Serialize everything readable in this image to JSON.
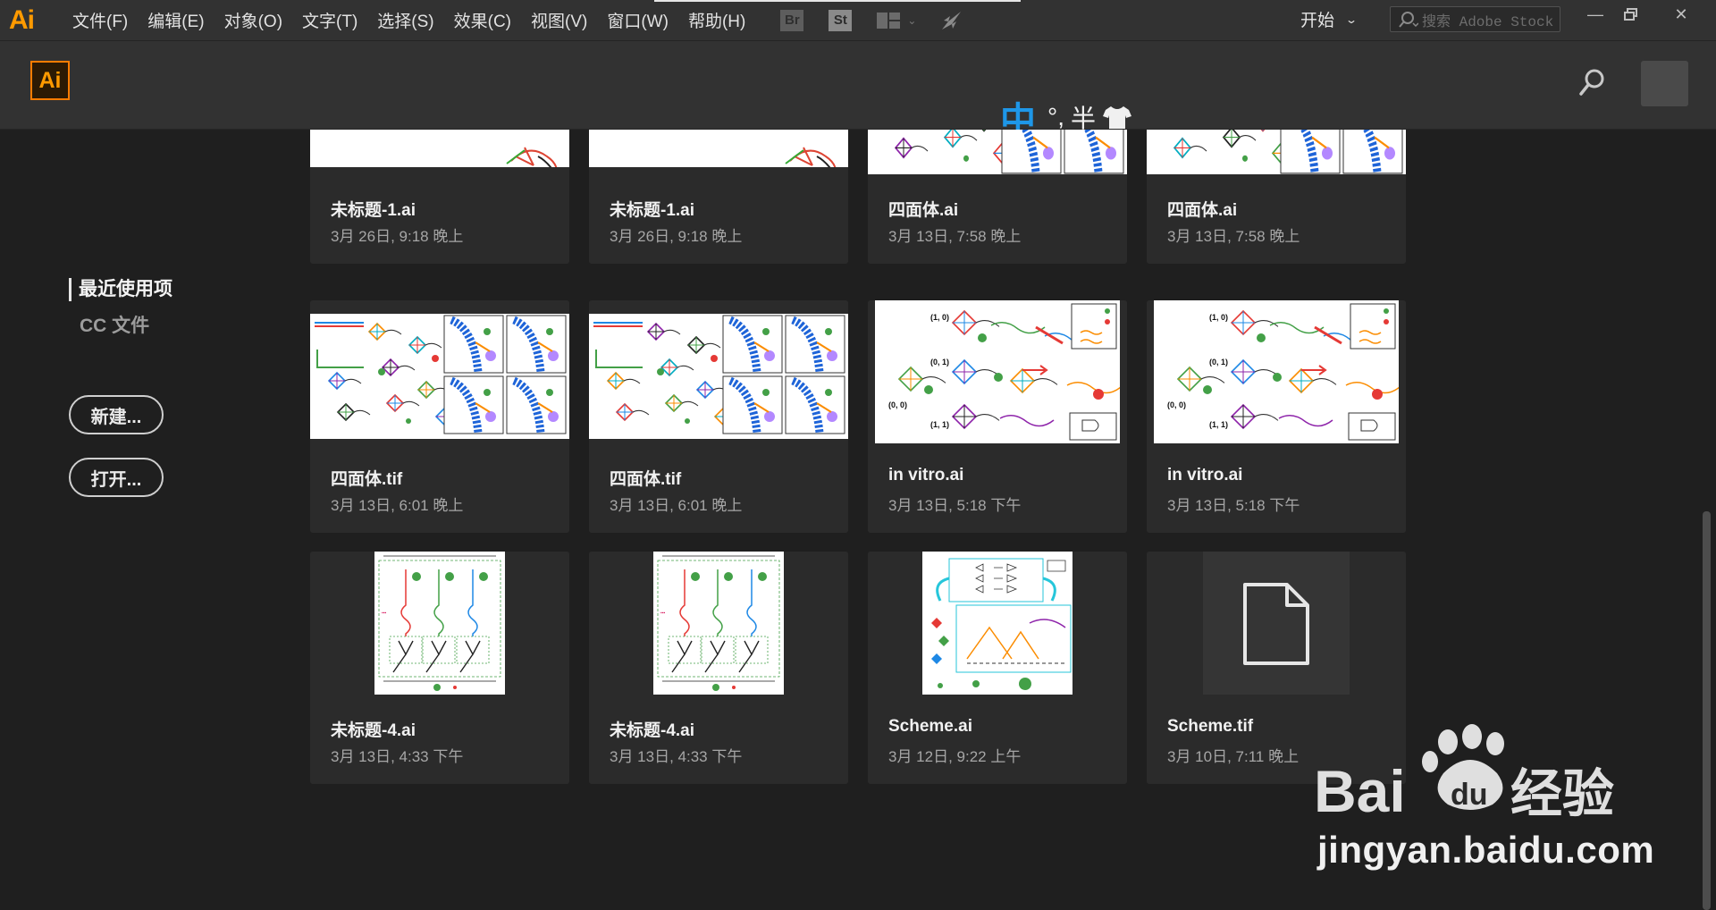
{
  "app": {
    "short_name": "Ai"
  },
  "menubar": {
    "items": [
      "文件(F)",
      "编辑(E)",
      "对象(O)",
      "文字(T)",
      "选择(S)",
      "效果(C)",
      "视图(V)",
      "窗口(W)",
      "帮助(H)"
    ],
    "bridge_label": "Br",
    "stock_label": "St",
    "workspace_label": "开始",
    "stock_search_placeholder": "搜索 Adobe Stock",
    "window_controls": [
      "minimize-icon",
      "restore-icon",
      "close-icon"
    ]
  },
  "header": {
    "logo_text": "Ai",
    "ime": {
      "mode": "中",
      "punct": "°,",
      "width": "半"
    }
  },
  "sidebar": {
    "nav": [
      {
        "label": "最近使用项",
        "active": true
      },
      {
        "label": "CC 文件",
        "active": false
      }
    ],
    "buttons": {
      "new_label": "新建...",
      "open_label": "打开..."
    }
  },
  "files": [
    {
      "name": "未标题-1.ai",
      "date": "3月 26日, 9:18 晚上",
      "thumb": "partial-diagram"
    },
    {
      "name": "未标题-1.ai",
      "date": "3月 26日, 9:18 晚上",
      "thumb": "partial-diagram"
    },
    {
      "name": "四面体.ai",
      "date": "3月 13日, 7:58 晚上",
      "thumb": "tetra-wide"
    },
    {
      "name": "四面体.ai",
      "date": "3月 13日, 7:58 晚上",
      "thumb": "tetra-wide"
    },
    {
      "name": "四面体.tif",
      "date": "3月 13日, 6:01 晚上",
      "thumb": "tetra-wide"
    },
    {
      "name": "四面体.tif",
      "date": "3月 13日, 6:01 晚上",
      "thumb": "tetra-wide"
    },
    {
      "name": "in vitro.ai",
      "date": "3月 13日, 5:18 下午",
      "thumb": "invitro"
    },
    {
      "name": "in vitro.ai",
      "date": "3月 13日, 5:18 下午",
      "thumb": "invitro"
    },
    {
      "name": "未标题-4.ai",
      "date": "3月 13日, 4:33 下午",
      "thumb": "portrait"
    },
    {
      "name": "未标题-4.ai",
      "date": "3月 13日, 4:33 下午",
      "thumb": "portrait"
    },
    {
      "name": "Scheme.ai",
      "date": "3月 12日, 9:22 上午",
      "thumb": "scheme"
    },
    {
      "name": "Scheme.tif",
      "date": "3月 10日, 7:11 晚上",
      "thumb": "generic-doc"
    }
  ],
  "watermark": {
    "brand": "Baidu经验",
    "url": "jingyan.baidu.com"
  },
  "colors": {
    "accent": "#ff9a00",
    "ime_blue": "#1e97e8",
    "bg": "#1f1f1f",
    "panel": "#323232",
    "card": "#2b2b2b"
  }
}
